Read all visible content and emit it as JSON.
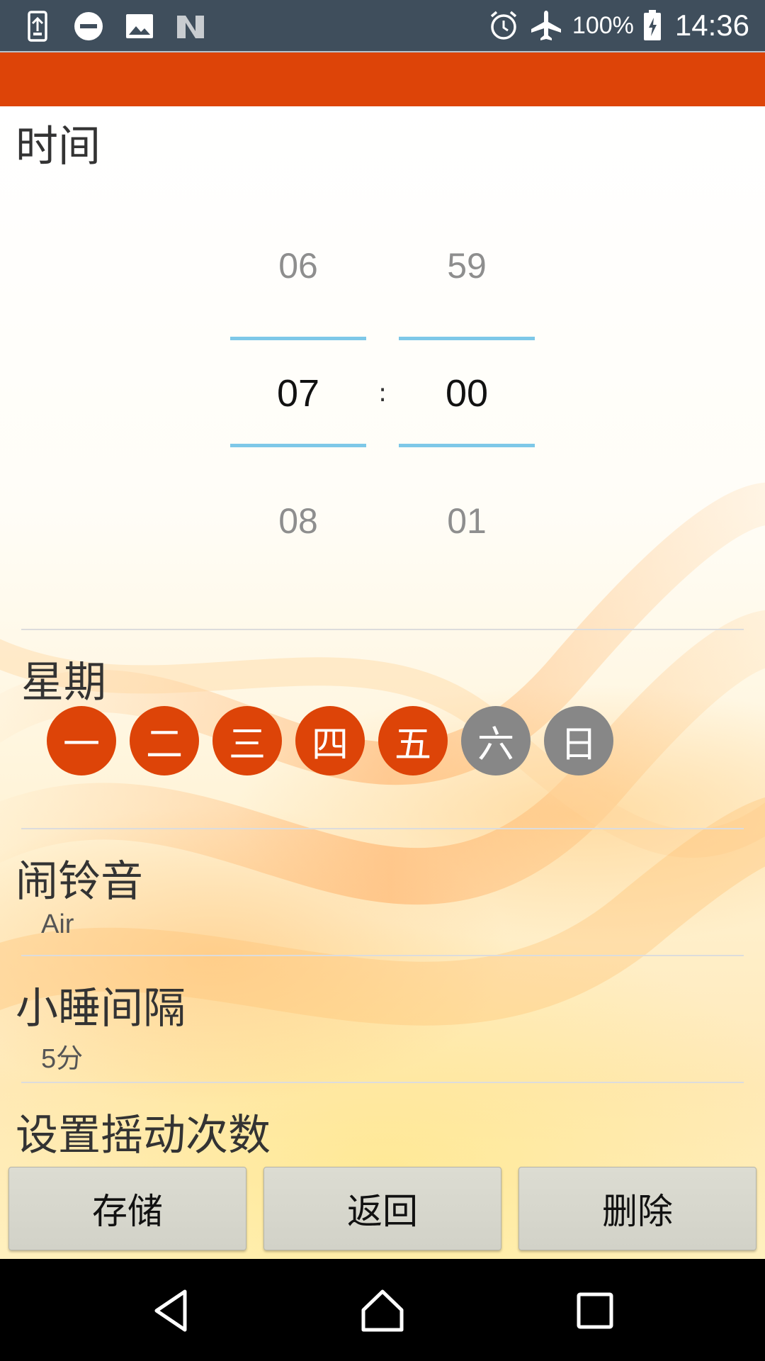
{
  "status_bar": {
    "icons_left": [
      "usb-transfer-icon",
      "do-not-disturb-icon",
      "image-icon",
      "n-logo-icon"
    ],
    "icons_right": [
      "alarm-icon",
      "airplane-icon",
      "battery-charging-icon"
    ],
    "battery": "100%",
    "time": "14:36"
  },
  "colors": {
    "accent": "#dd4408",
    "inactive_day": "#878787",
    "picker_line": "#7ec8e8",
    "statusbar": "#3f4e5c"
  },
  "time_section": {
    "title": "时间",
    "hour": {
      "prev": "06",
      "current": "07",
      "next": "08"
    },
    "minute": {
      "prev": "59",
      "current": "00",
      "next": "01"
    },
    "separator": ":"
  },
  "weekday_section": {
    "title": "星期",
    "days": [
      {
        "label": "一",
        "selected": true
      },
      {
        "label": "二",
        "selected": true
      },
      {
        "label": "三",
        "selected": true
      },
      {
        "label": "四",
        "selected": true
      },
      {
        "label": "五",
        "selected": true
      },
      {
        "label": "六",
        "selected": false
      },
      {
        "label": "日",
        "selected": false
      }
    ]
  },
  "ringtone": {
    "title": "闹铃音",
    "value": "Air"
  },
  "snooze": {
    "title": "小睡间隔",
    "value": "5分"
  },
  "shake": {
    "title": "设置摇动次数"
  },
  "buttons": {
    "save": "存储",
    "back": "返回",
    "delete": "删除"
  },
  "nav_bar": [
    "back-icon",
    "home-icon",
    "recents-icon"
  ]
}
